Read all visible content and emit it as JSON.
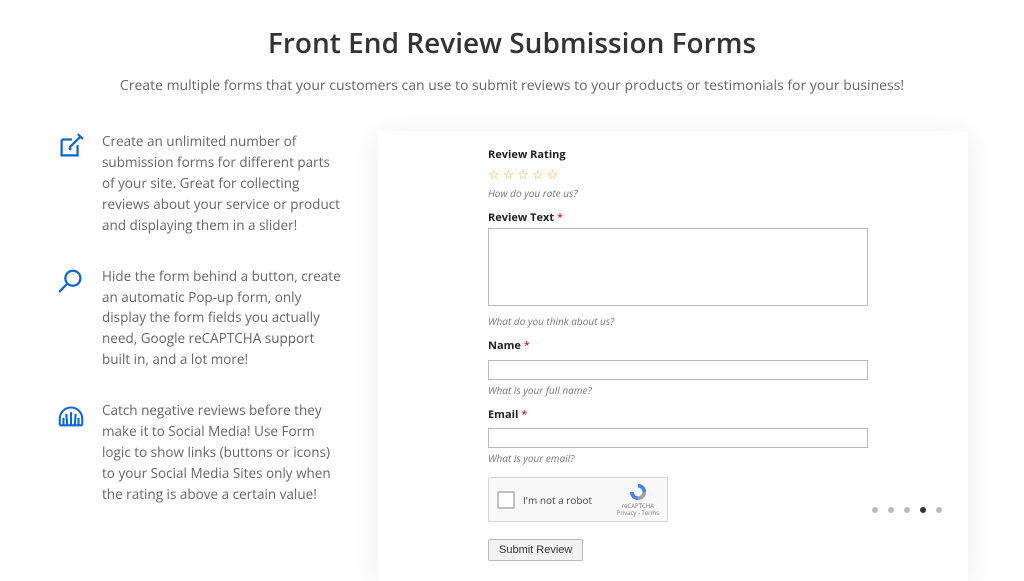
{
  "heading": {
    "title": "Front End Review Submission Forms",
    "subtitle": "Create multiple forms that your customers can use to submit reviews to your products or testimonials for your business!"
  },
  "features": [
    {
      "text": "Create an unlimited number of submission forms for different parts of your site. Great for collecting reviews about your service or product and displaying them in a slider!"
    },
    {
      "text": "Hide the form behind a button, create an automatic Pop-up form, only display the form fields you actually need, Google reCAPTCHA support built in, and a lot more!"
    },
    {
      "text": "Catch negative reviews before they make it to Social Media! Use Form logic to show links (buttons or icons) to your Social Media Sites only when the rating is above a certain value!"
    }
  ],
  "form": {
    "rating_label": "Review Rating",
    "rating_help": "How do you rate us?",
    "review_label": "Review Text",
    "review_help": "What do you think about us?",
    "name_label": "Name",
    "name_help": "What is your full name?",
    "email_label": "Email",
    "email_help": "What is your email?",
    "required_mark": "*",
    "captcha_text": "I'm not a robot",
    "captcha_brand": "reCAPTCHA",
    "captcha_terms": "Privacy - Terms",
    "submit_label": "Submit Review"
  },
  "carousel": {
    "total": 5,
    "active_index": 3
  }
}
